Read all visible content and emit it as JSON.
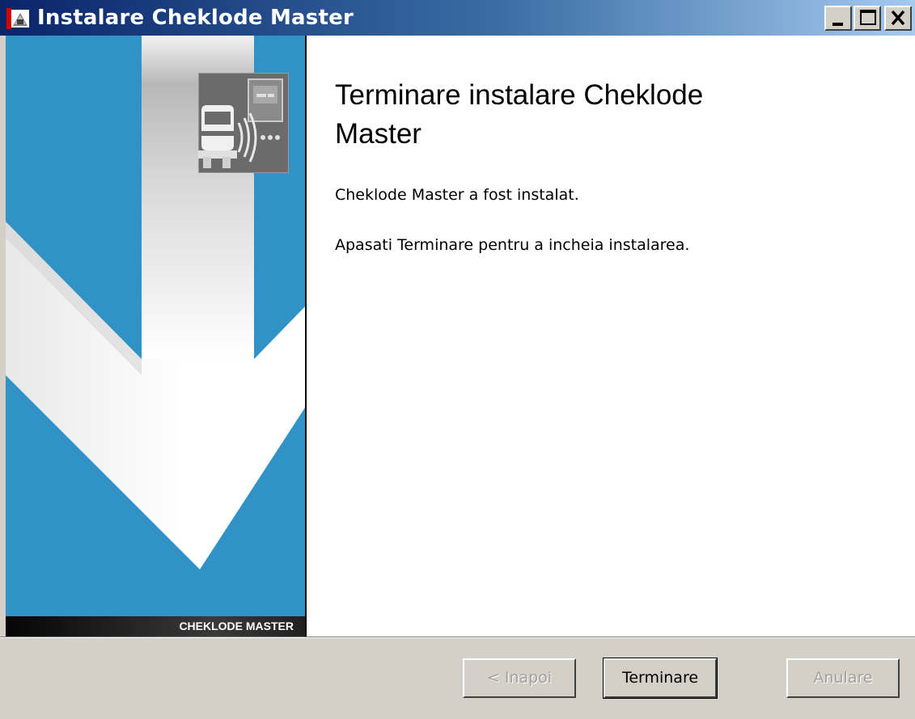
{
  "window": {
    "title": "Instalare Cheklode Master",
    "controls": [
      "minimize-icon",
      "maximize-icon",
      "close-icon"
    ]
  },
  "banner": {
    "brand_label": "CHEKLODE MASTER",
    "colors": {
      "background": "#3092c6",
      "arrow": "#ffffff"
    }
  },
  "content": {
    "heading": "Terminare instalare Cheklode Master",
    "line1": "Cheklode Master a fost instalat.",
    "line2": "Apasati Terminare pentru a incheia instalarea."
  },
  "buttons": {
    "back": "< Inapoi",
    "finish": "Terminare",
    "cancel": "Anulare"
  }
}
